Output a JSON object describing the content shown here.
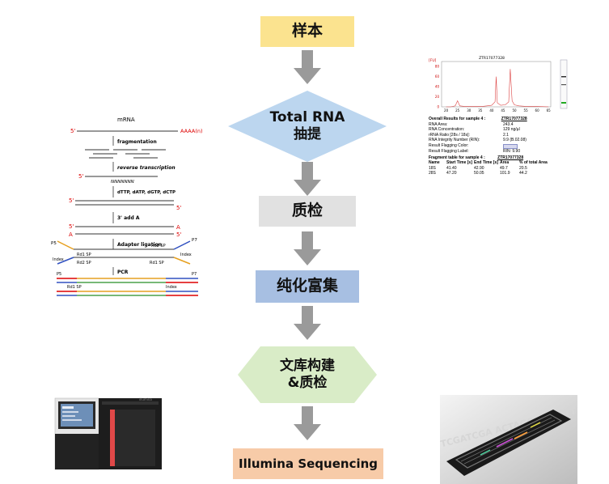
{
  "flow": {
    "step1": "样本",
    "step2": "Total RNA\n抽提",
    "step3": "质检",
    "step4": "纯化富集",
    "step5": "文库构建\n&质检",
    "step6": "Illumina Sequencing"
  },
  "colors": {
    "step1": "#fbe38f",
    "step2": "#bcd6ef",
    "step3": "#e1e1e1",
    "step4": "#a7bfe2",
    "step5": "#d9ecc7",
    "step6": "#f7cba8",
    "arrow": "#9a9a9a"
  },
  "library_prep": {
    "mrna_label": "mRNA",
    "poly_a": "AAAA(n)",
    "five_prime": "5'",
    "three_prime": "3'",
    "fragmentation": "fragmentation",
    "reverse_transcription": "reverse  transcription",
    "random_primer": "NNNNNNN",
    "dntps": "dTTP,  dATP,  dGTP,  dCTP",
    "add_a": "3' add A",
    "a_base": "A",
    "adapter_ligation": "Adapter ligation",
    "pcr": "PCR",
    "rd1_sp": "Rd1 SP",
    "rd2_sp": "Rd2 SP",
    "index": "Index",
    "p5": "P5",
    "p7": "P7"
  },
  "bioanalyzer": {
    "chart_title": "ZTR17077328",
    "y_unit": "[FU]",
    "y_ticks": [
      "80",
      "60",
      "40",
      "20",
      "0"
    ],
    "x_ticks": [
      "20",
      "25",
      "30",
      "35",
      "40",
      "45",
      "50",
      "55",
      "60",
      "65"
    ],
    "overall_title": "Overall Results for sample 4 :",
    "overall_sample": "ZTR17077328",
    "rows": [
      {
        "label": "RNA Area:",
        "value": "243.4"
      },
      {
        "label": "RNA Concentration:",
        "value": "129 ng/µl"
      },
      {
        "label": "rRNA Ratio [28s / 18s]:",
        "value": "2.1"
      },
      {
        "label": "RNA Integrity Number (RIN):",
        "value": "9.9  (B.02.08)"
      },
      {
        "label": "Result Flagging Color:",
        "value": ""
      },
      {
        "label": "Result Flagging Label:",
        "value": "RIN: 9.90"
      }
    ],
    "fragment_title": "Fragment table for sample 4 :",
    "fragment_sample": "ZTR17077328",
    "table_headers": [
      "Name",
      "Start Time [s]",
      "End Time [s]",
      "Area",
      "% of total Area"
    ],
    "table_rows": [
      [
        "18S",
        "41.40",
        "42.90",
        "49.7",
        "20.5"
      ],
      [
        "28S",
        "47.20",
        "50.05",
        "101.9",
        "44.2"
      ]
    ]
  },
  "chart_data": {
    "type": "line",
    "title": "ZTR17077328",
    "ylabel": "[FU]",
    "xlabel": "",
    "x": [
      20,
      22,
      24,
      25,
      26,
      28,
      30,
      32,
      34,
      36,
      38,
      40,
      41.5,
      42,
      42.5,
      44,
      46,
      47.5,
      48.2,
      49,
      50,
      52,
      55,
      60,
      65
    ],
    "series": [
      {
        "values": [
          0,
          0,
          2,
          12,
          2,
          1,
          1,
          1,
          1,
          1,
          2,
          3,
          10,
          60,
          8,
          3,
          4,
          10,
          75,
          12,
          4,
          2,
          1,
          1,
          0
        ]
      }
    ],
    "xlim": [
      18,
      66
    ],
    "ylim": [
      0,
      90
    ],
    "grid": false
  },
  "sequencer": {
    "brand": "illumina"
  },
  "flow_cell": {
    "bases": "TCGATCGA  ACTAGG  AAAGTT  TCA  GGT  CCGAC"
  }
}
